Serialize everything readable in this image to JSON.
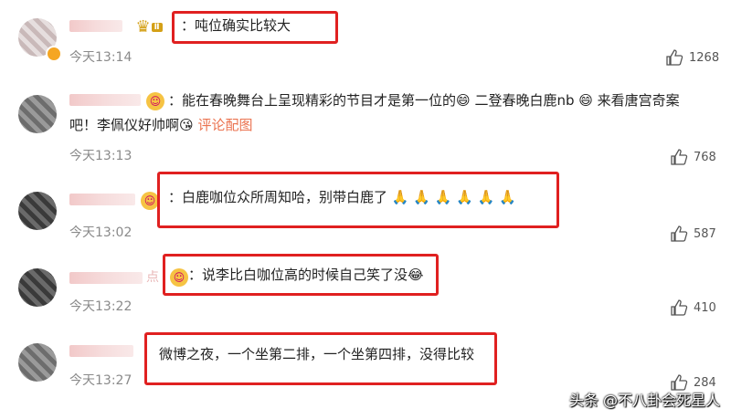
{
  "comments": [
    {
      "text": "：吨位确实比较大",
      "time": "今天13:14",
      "likes": "1268",
      "badge": "Ⅱ"
    },
    {
      "text_line1_a": "：能在春晚舞台上呈现精彩的节目才是第一位的",
      "text_line1_b": "二登春晚白鹿nb",
      "text_line1_c": "来看唐宫奇案",
      "text_line2_a": "吧！李佩仪好帅啊",
      "text_line2_link": "评论配图",
      "time": "今天13:13",
      "likes": "768"
    },
    {
      "text": "：白鹿咖位众所周知哈，别带白鹿了",
      "time": "今天13:02",
      "likes": "587"
    },
    {
      "text": "：说李比白咖位高的时候自己笑了没",
      "time": "今天13:22",
      "likes": "410",
      "name_suffix": "点"
    },
    {
      "text": "微博之夜，一个坐第二排，一个坐第四排，没得比较",
      "time": "今天13:27",
      "likes": "284"
    }
  ],
  "watermark": "头条 @不八卦会死星人",
  "colors": {
    "highlight": "#e02020",
    "link": "#eb7350",
    "time": "#8a8a8a"
  }
}
